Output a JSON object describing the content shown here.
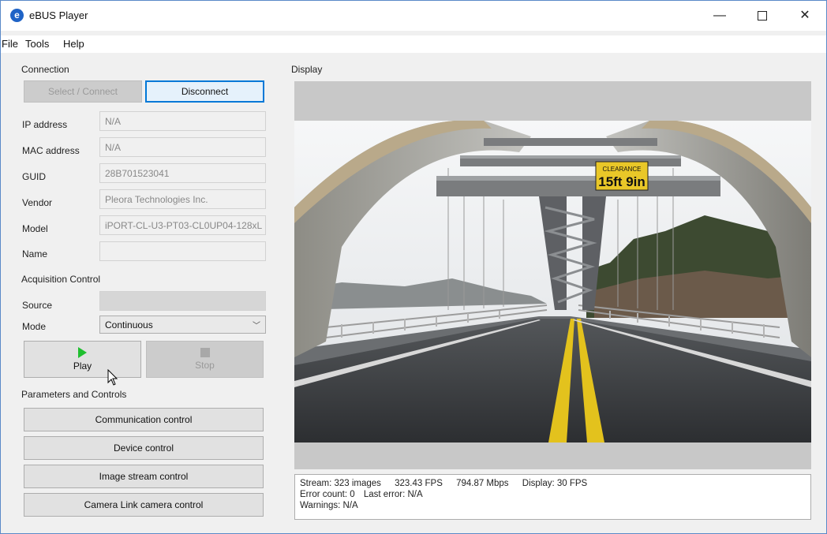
{
  "window": {
    "title": "eBUS Player",
    "app_icon": "e"
  },
  "menu": [
    "File",
    "Tools",
    "Help"
  ],
  "connection": {
    "label": "Connection",
    "select_connect": "Select / Connect",
    "disconnect": "Disconnect",
    "fields": [
      {
        "label": "IP address",
        "value": "N/A"
      },
      {
        "label": "MAC address",
        "value": "N/A"
      },
      {
        "label": "GUID",
        "value": "28B701523041"
      },
      {
        "label": "Vendor",
        "value": "Pleora Technologies Inc."
      },
      {
        "label": "Model",
        "value": "iPORT-CL-U3-PT03-CL0UP04-128xL"
      },
      {
        "label": "Name",
        "value": ""
      }
    ]
  },
  "acquisition": {
    "label": "Acquisition Control",
    "source_label": "Source",
    "source_value": "",
    "mode_label": "Mode",
    "mode_value": "Continuous",
    "play": "Play",
    "stop": "Stop"
  },
  "parameters": {
    "label": "Parameters and Controls",
    "buttons": [
      "Communication control",
      "Device control",
      "Image stream control",
      "Camera Link camera control"
    ]
  },
  "display": {
    "label": "Display",
    "sign_top": "CLEARANCE",
    "sign_bottom": "15ft 9in",
    "status": {
      "stream": "Stream: 323 images",
      "fps": "323.43 FPS",
      "mbps": "794.87 Mbps",
      "display_fps": "Display: 30 FPS",
      "error_count": "Error count: 0",
      "last_error": "Last error: N/A",
      "warnings": "Warnings: N/A"
    }
  },
  "colors": {
    "accent": "#0078d7",
    "play_green": "#1fbf2f",
    "title_icon": "#1f63c6"
  }
}
